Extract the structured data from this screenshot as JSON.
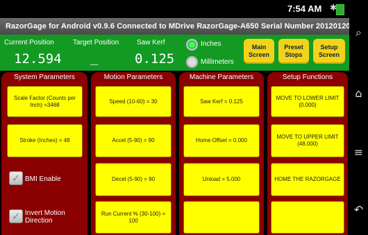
{
  "status": {
    "time": "7:54 AM"
  },
  "titlebar": {
    "text": "RazorGage for Android v0.9.6  Connected to MDrive RazorGage-A650  Serial Number 20120120"
  },
  "header": {
    "current_position_label": "Current Position",
    "current_position_value": "12.594",
    "target_position_label": "Target Position",
    "target_position_value": "_",
    "saw_kerf_label": "Saw Kerf",
    "saw_kerf_value": "0.125",
    "units": [
      {
        "label": "Inches",
        "selected": true
      },
      {
        "label": "Millimeters",
        "selected": false
      }
    ],
    "buttons": [
      {
        "label": "Main Screen"
      },
      {
        "label": "Preset Stops"
      },
      {
        "label": "Setup Screen"
      }
    ]
  },
  "columns": {
    "system": {
      "title": "System Parameters",
      "scale_factor": "Scale Factor (Counts per Inch) =3468",
      "stroke": "Stroke (Inches) = 48",
      "bmi_enable": "BMI Enable",
      "invert_motion": "Invert Motion Direction"
    },
    "motion": {
      "title": "Motion Parameters",
      "items": [
        "Speed (10-60) = 30",
        "Accel (5-90) = 90",
        "Decel (5-90) = 90",
        "Run Current % (30-100) = 100"
      ]
    },
    "machine": {
      "title": "Machine Parameters",
      "items": [
        "Saw Kerf = 0.125",
        "Home Offset = 0.000",
        "Unload = 5.000",
        ""
      ]
    },
    "setup": {
      "title": "Setup Functions",
      "items": [
        "MOVE TO LOWER LIMIT (0.000)",
        "MOVE TO UPPER LIMIT (48.000)",
        "HOME THE RAZORGAGE",
        ""
      ]
    }
  },
  "colors": {
    "header_green": "#139a23",
    "column_red": "#8b0000",
    "cell_yellow": "#ffff00",
    "button_yellow": "#f2d31c"
  },
  "icons": [
    "bluetooth-icon",
    "wifi-icon",
    "battery-icon",
    "search-icon",
    "home-icon",
    "menu-icon",
    "back-icon"
  ]
}
